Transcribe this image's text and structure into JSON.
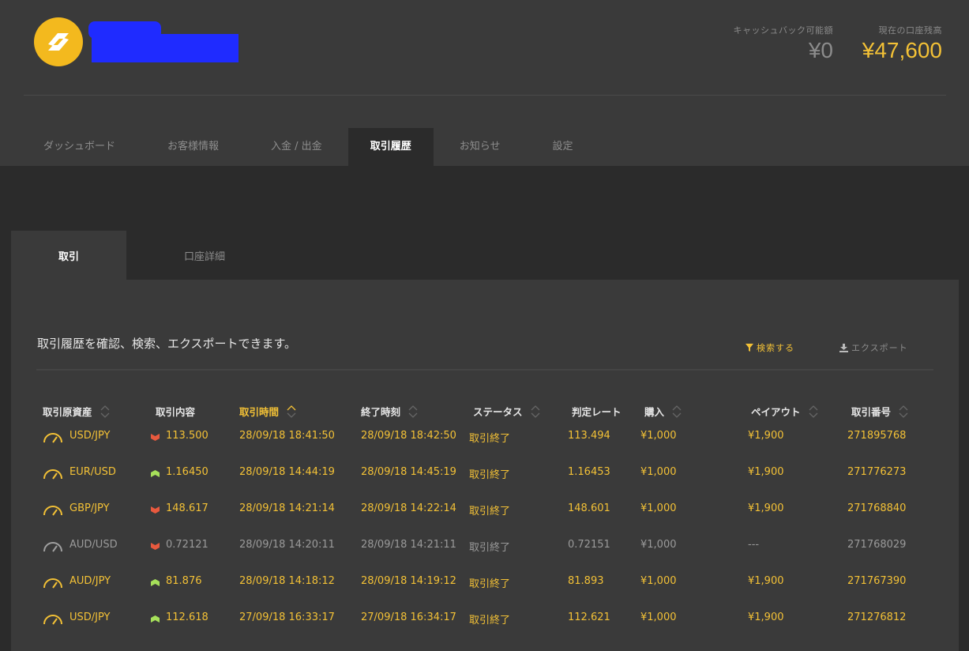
{
  "header": {
    "cashback_label": "キャッシュバック可能額",
    "cashback_value": "¥0",
    "balance_label": "現在の口座残高",
    "balance_value": "¥47,600"
  },
  "nav": {
    "items": [
      {
        "label": "ダッシュボード"
      },
      {
        "label": "お客様情報"
      },
      {
        "label": "入金 / 出金"
      },
      {
        "label": "取引履歴"
      },
      {
        "label": "お知らせ"
      },
      {
        "label": "設定"
      }
    ],
    "active": "取引履歴"
  },
  "subtabs": [
    {
      "label": "取引"
    },
    {
      "label": "口座詳細"
    }
  ],
  "panel": {
    "description": "取引履歴を確認、検索、エクスポートできます。",
    "search_label": "検索する",
    "export_label": "エクスポート"
  },
  "table": {
    "columns": [
      "取引原資産",
      "取引内容",
      "取引時間",
      "終了時刻",
      "ステータス",
      "判定レート",
      "購入",
      "ペイアウト",
      "取引番号"
    ],
    "sorted_column": "取引時間",
    "rows": [
      {
        "asset": "USD/JPY",
        "direction": "down",
        "rate": "113.500",
        "start": "28/09/18 18:41:50",
        "end": "28/09/18 18:42:50",
        "status": "取引終了",
        "judge": "113.494",
        "buy": "¥1,000",
        "payout": "¥1,900",
        "id": "271895768",
        "win": true
      },
      {
        "asset": "EUR/USD",
        "direction": "up",
        "rate": "1.16450",
        "start": "28/09/18 14:44:19",
        "end": "28/09/18 14:45:19",
        "status": "取引終了",
        "judge": "1.16453",
        "buy": "¥1,000",
        "payout": "¥1,900",
        "id": "271776273",
        "win": true
      },
      {
        "asset": "GBP/JPY",
        "direction": "down",
        "rate": "148.617",
        "start": "28/09/18 14:21:14",
        "end": "28/09/18 14:22:14",
        "status": "取引終了",
        "judge": "148.601",
        "buy": "¥1,000",
        "payout": "¥1,900",
        "id": "271768840",
        "win": true
      },
      {
        "asset": "AUD/USD",
        "direction": "down",
        "rate": "0.72121",
        "start": "28/09/18 14:20:11",
        "end": "28/09/18 14:21:11",
        "status": "取引終了",
        "judge": "0.72151",
        "buy": "¥1,000",
        "payout": "---",
        "id": "271768029",
        "win": false
      },
      {
        "asset": "AUD/JPY",
        "direction": "up",
        "rate": "81.876",
        "start": "28/09/18 14:18:12",
        "end": "28/09/18 14:19:12",
        "status": "取引終了",
        "judge": "81.893",
        "buy": "¥1,000",
        "payout": "¥1,900",
        "id": "271767390",
        "win": true
      },
      {
        "asset": "USD/JPY",
        "direction": "up",
        "rate": "112.618",
        "start": "27/09/18 16:33:17",
        "end": "27/09/18 16:34:17",
        "status": "取引終了",
        "judge": "112.621",
        "buy": "¥1,000",
        "payout": "¥1,900",
        "id": "271276812",
        "win": true
      }
    ]
  },
  "colors": {
    "accent": "#f3c136",
    "down": "#e8593e",
    "up": "#a6e05a",
    "redaction": "#1f2bff"
  }
}
